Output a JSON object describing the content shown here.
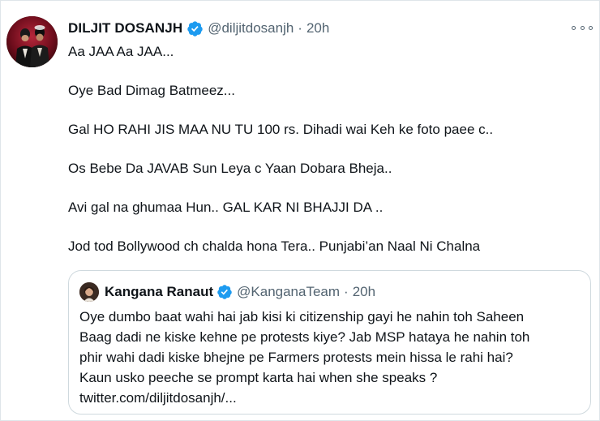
{
  "tweet": {
    "author": {
      "name": "DILJIT DOSANJH",
      "handle": "@diljitdosanjh",
      "verified": true
    },
    "separator": "·",
    "time": "20h",
    "more_icon": "more-horizontal-icon",
    "lines": [
      "Aa JAA Aa JAA...",
      "Oye Bad Dimag Batmeez...",
      "Gal HO RAHI JIS MAA NU TU 100 rs. Dihadi wai Keh ke foto paee c..",
      "Os Bebe Da JAVAB Sun Leya c Yaan Dobara Bheja..",
      "Avi gal na ghumaa Hun.. GAL KAR NI BHAJJI DA ..",
      "Jod tod Bollywood ch chalda hona Tera.. Punjabi’an Naal Ni Chalna"
    ]
  },
  "quote": {
    "author": {
      "name": "Kangana Ranaut",
      "handle": "@KanganaTeam",
      "verified": true
    },
    "separator": "·",
    "time": "20h",
    "text": "Oye dumbo baat wahi hai jab kisi ki citizenship gayi he nahin toh Saheen\nBaag dadi ne kiske kehne pe protests kiye? Jab MSP hataya he nahin toh\nphir wahi dadi kiske bhejne pe Farmers protests mein hissa le rahi hai?\nKaun usko peeche se prompt karta hai when she speaks ?\ntwitter.com/diljitdosanjh/..."
  },
  "colors": {
    "text_primary": "#0f1419",
    "text_secondary": "#536471",
    "verified_blue": "#1d9bf0",
    "border": "#cfd9de"
  }
}
